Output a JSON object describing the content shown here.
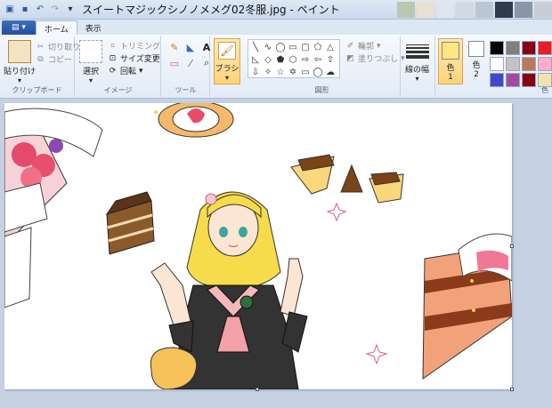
{
  "title": "スイートマジックシノノメメグ02冬服.jpg - ペイント",
  "tabs": {
    "file": "▤ ▾",
    "home": "ホーム",
    "view": "表示"
  },
  "clipboard": {
    "paste": "貼り付け",
    "cut": "切り取り",
    "copy": "コピー",
    "label": "クリップボード"
  },
  "image": {
    "select": "選択",
    "crop": "トリミング",
    "resize": "サイズ変更",
    "rotate": "回転",
    "label": "イメージ"
  },
  "tools": {
    "label": "ツール"
  },
  "brushes": {
    "label": "ブラシ"
  },
  "shapes": {
    "outline": "輪郭",
    "fill": "塗りつぶし",
    "label": "図形"
  },
  "size": {
    "label": "線の幅"
  },
  "colors": {
    "color1_label": "色",
    "color1_num": "1",
    "color2_label": "色",
    "color2_num": "2",
    "group_label": "色",
    "palette": [
      "#000000",
      "#7f7f7f",
      "#880015",
      "#ed1c24",
      "#ff7f27",
      "#ffffff",
      "#c3c3c3",
      "#b97a57",
      "#ffaec9",
      "#ffc90e",
      "#3f48cc",
      "#a349a4",
      "#880015",
      "#efe4b0",
      "#fff200"
    ]
  }
}
